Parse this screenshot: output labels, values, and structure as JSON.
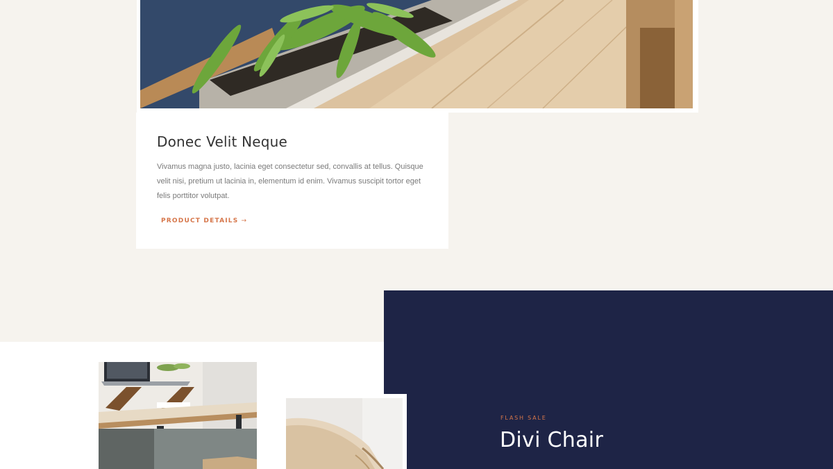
{
  "featured_product": {
    "title": "Donec Velit Neque",
    "description": "Vivamus magna justo, lacinia eget consectetur sed, convallis at tellus. Quisque velit nisi, pretium ut lacinia in, elementum id enim. Vivamus suscipit tortor eget felis porttitor volutpat.",
    "link_label": "PRODUCT DETAILS",
    "link_arrow": "→"
  },
  "flash_sale": {
    "label": "FLASH SALE",
    "title": "Divi Chair"
  },
  "colors": {
    "page_background": "#f6f3ee",
    "accent": "#d6764a",
    "navy": "#1e2446",
    "card_background": "#ffffff"
  },
  "images": {
    "hero": "fern-planter-on-wooden-shelf-photo",
    "desk": "laptop-on-wooden-desk-photo",
    "chair": "folded-leather-chair-photo"
  }
}
